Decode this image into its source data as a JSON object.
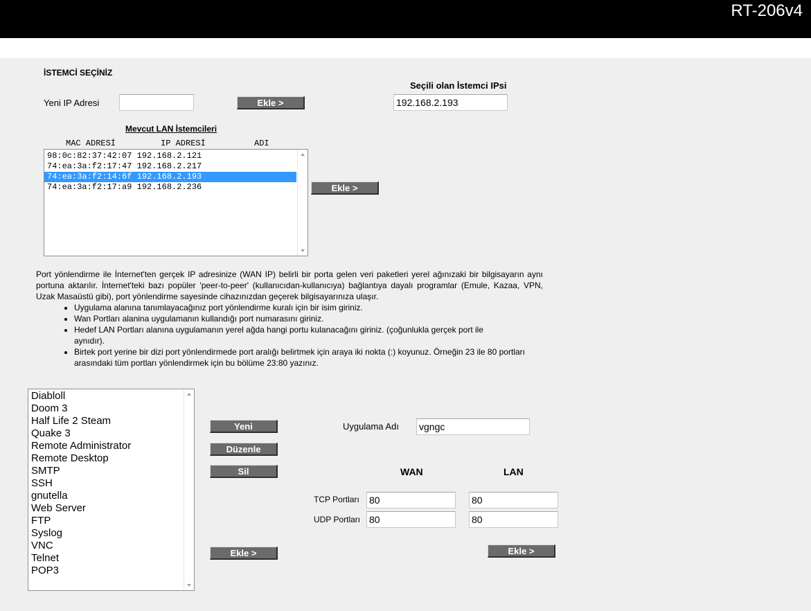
{
  "header": {
    "model": "RT-206v4"
  },
  "client": {
    "section_title": "İSTEMCİ SEÇİNİZ",
    "new_ip_label": "Yeni IP Adresi",
    "new_ip_value": "",
    "add_button": "Ekle >",
    "selected_label": "Seçili olan İstemci IPsi",
    "selected_value": "192.168.2.193"
  },
  "lan_clients": {
    "title": "Mevcut LAN İstemcileri",
    "headers": [
      "MAC ADRESİ",
      "IP ADRESİ",
      "ADI"
    ],
    "rows": [
      {
        "mac": "98:0c:82:37:42:07",
        "ip": "192.168.2.121",
        "name": "",
        "selected": false
      },
      {
        "mac": "74:ea:3a:f2:17:47",
        "ip": "192.168.2.217",
        "name": "",
        "selected": false
      },
      {
        "mac": "74:ea:3a:f2:14:6f",
        "ip": "192.168.2.193",
        "name": "",
        "selected": true
      },
      {
        "mac": "74:ea:3a:f2:17:a9",
        "ip": "192.168.2.236",
        "name": "",
        "selected": false
      }
    ],
    "add_button": "Ekle >"
  },
  "info": {
    "paragraph": "Port yönlendirme ile İnternet'ten gerçek IP adresinize (WAN IP) belirli bir porta gelen veri paketleri yerel ağınızaki bir bilgisayarın aynı portuna aktarılır. İnternet'teki bazı popüler 'peer-to-peer' (kullanıcıdan-kullanıcıya) bağlantıya dayalı programlar (Emule, Kazaa, VPN, Uzak Masaüstü gibi), port yönlendirme sayesinde cihazınızdan geçerek bilgisayarınıza ulaşır.",
    "bullets": [
      "Uygulama alanına tanımlayacağınız port yönlendirme kuralı için bir isim giriniz.",
      "Wan Portları alanina uygulamanın kullandığı port numarasını giriniz.",
      "Hedef LAN Portları alanına uygulamanın yerel ağda hangi portu kulanacağını giriniz. (çoğunlukla gerçek port ile aynıdır).",
      "Birtek port yerine bir dizi port yönlendirmede port aralığı belirtmek için araya iki nokta (:) koyunuz. Örneğin 23 ile 80 portları arasındaki tüm portları yönlendirmek için bu bölüme 23:80 yazınız."
    ]
  },
  "applications": {
    "items": [
      "Diabloll",
      "Doom 3",
      "Half Life 2 Steam",
      "Quake 3",
      "Remote Administrator",
      "Remote Desktop",
      "SMTP",
      "SSH",
      "gnutella",
      "Web Server",
      "FTP",
      "Syslog",
      "VNC",
      "Telnet",
      "POP3"
    ],
    "new_button": "Yeni",
    "edit_button": "Düzenle",
    "delete_button": "Sil",
    "add_button_left": "Ekle >",
    "add_button_right": "Ekle >"
  },
  "rule": {
    "app_name_label": "Uygulama Adı",
    "app_name_value": "vgngc",
    "wan_header": "WAN",
    "lan_header": "LAN",
    "tcp_label": "TCP Portları",
    "udp_label": "UDP Portları",
    "tcp_wan": "80",
    "tcp_lan": "80",
    "udp_wan": "80",
    "udp_lan": "80"
  }
}
